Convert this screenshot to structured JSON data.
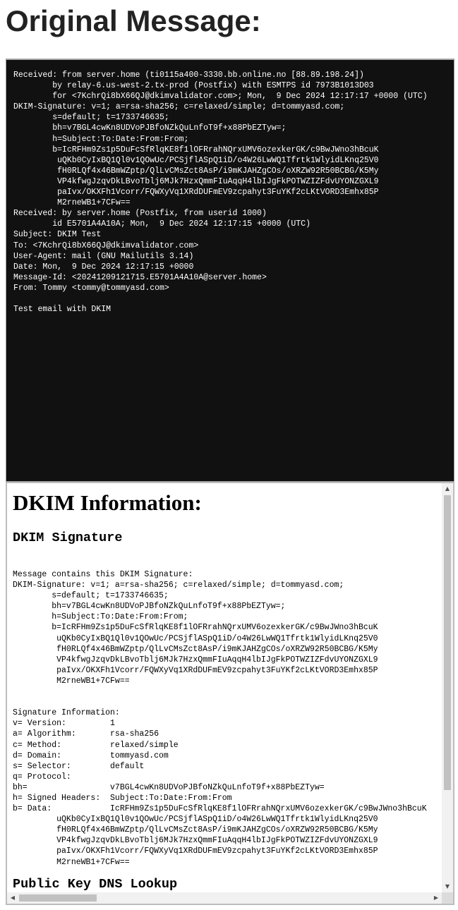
{
  "page": {
    "heading": "Original Message:"
  },
  "raw_message": {
    "text": "Received: from server.home (ti0115a400-3330.bb.online.no [88.89.198.24])\n        by relay-6.us-west-2.tx-prod (Postfix) with ESMTPS id 7973B1013D03\n        for <7KchrQi8bX66QJ@dkimvalidator.com>; Mon,  9 Dec 2024 12:17:17 +0000 (UTC)\nDKIM-Signature: v=1; a=rsa-sha256; c=relaxed/simple; d=tommyasd.com;\n        s=default; t=1733746635;\n        bh=v7BGL4cwKn8UDVoPJBfoNZkQuLnfoT9f+x88PbEZTyw=;\n        h=Subject:To:Date:From:From;\n        b=IcRFHm9Zs1p5DuFcSfRlqKE8f1lOFRrahNQrxUMV6ozexkerGK/c9BwJWno3hBcuK\n         uQKb0CyIxBQ1Ql0v1QOwUc/PCSjflASpQ1iD/o4W26LwWQ1Tfrtk1WlyidLKnq25V0\n         fH0RLQf4x46BmWZptp/QlLvCMsZct8AsP/i9mKJAHZgCOs/oXRZW92R50BCBG/K5My\n         VP4kfwgJzqvDkLBvoTblj6MJk7HzxQmmFIuAqqH4lbIJgFkPOTWZIZFdvUYONZGXL9\n         paIvx/OKXFh1Vcorr/FQWXyVq1XRdDUFmEV9zcpahyt3FuYKf2cLKtVORD3Emhx85P\n         M2rneWB1+7CFw==\nReceived: by server.home (Postfix, from userid 1000)\n        id E5701A4A10A; Mon,  9 Dec 2024 12:17:15 +0000 (UTC)\nSubject: DKIM Test\nTo: <7KchrQi8bX66QJ@dkimvalidator.com>\nUser-Agent: mail (GNU Mailutils 3.14)\nDate: Mon,  9 Dec 2024 12:17:15 +0000\nMessage-Id: <20241209121715.E5701A4A10A@server.home>\nFrom: Tommy <tommy@tommyasd.com>\n\nTest email with DKIM"
  },
  "dkim_frame": {
    "heading": "DKIM Information:",
    "signature_heading": "DKIM Signature",
    "signature_text": "Message contains this DKIM Signature:\nDKIM-Signature: v=1; a=rsa-sha256; c=relaxed/simple; d=tommyasd.com;\n        s=default; t=1733746635;\n        bh=v7BGL4cwKn8UDVoPJBfoNZkQuLnfoT9f+x88PbEZTyw=;\n        h=Subject:To:Date:From:From;\n        b=IcRFHm9Zs1p5DuFcSfRlqKE8f1lOFRrahNQrxUMV6ozexkerGK/c9BwJWno3hBcuK\n         uQKb0CyIxBQ1Ql0v1QOwUc/PCSjflASpQ1iD/o4W26LwWQ1Tfrtk1WlyidLKnq25V0\n         fH0RLQf4x46BmWZptp/QlLvCMsZct8AsP/i9mKJAHZgCOs/oXRZW92R50BCBG/K5My\n         VP4kfwgJzqvDkLBvoTblj6MJk7HzxQmmFIuAqqH4lbIJgFkPOTWZIZFdvUYONZGXL9\n         paIvx/OKXFh1Vcorr/FQWXyVq1XRdDUFmEV9zcpahyt3FuYKf2cLKtVORD3Emhx85P\n         M2rneWB1+7CFw==\n\n\nSignature Information:\nv= Version:         1\na= Algorithm:       rsa-sha256\nc= Method:          relaxed/simple\nd= Domain:          tommyasd.com\ns= Selector:        default\nq= Protocol:\nbh=                 v7BGL4cwKn8UDVoPJBfoNZkQuLnfoT9f+x88PbEZTyw=\nh= Signed Headers:  Subject:To:Date:From:From\nb= Data:            IcRFHm9Zs1p5DuFcSfRlqKE8f1lOFRrahNQrxUMV6ozexkerGK/c9BwJWno3hBcuK\n         uQKb0CyIxBQ1Ql0v1QOwUc/PCSjflASpQ1iD/o4W26LwWQ1Tfrtk1WlyidLKnq25V0\n         fH0RLQf4x46BmWZptp/QlLvCMsZct8AsP/i9mKJAHZgCOs/oXRZW92R50BCBG/K5My\n         VP4kfwgJzqvDkLBvoTblj6MJk7HzxQmmFIuAqqH4lbIJgFkPOTWZIZFdvUYONZGXL9\n         paIvx/OKXFh1Vcorr/FQWXyVq1XRdDUFmEV9zcpahyt3FuYKf2cLKtVORD3Emhx85P\n         M2rneWB1+7CFw==",
    "public_key_heading": "Public Key DNS Lookup"
  },
  "scrollbars": {
    "up_arrow": "▲",
    "down_arrow": "▼",
    "left_arrow": "◀",
    "right_arrow": "▶"
  },
  "colors": {
    "raw_panel_background": "#111111",
    "raw_panel_text": "#ffffff",
    "heading_text": "#222222"
  }
}
